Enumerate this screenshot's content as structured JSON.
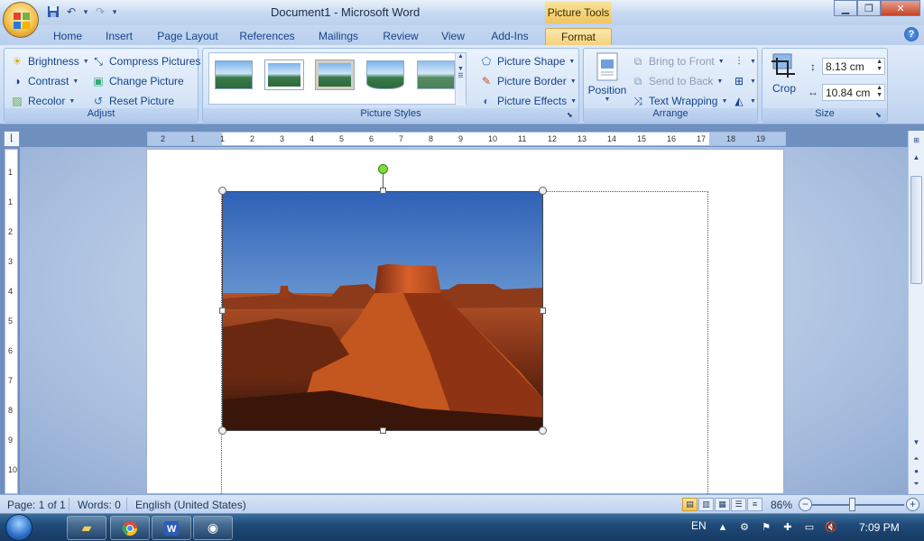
{
  "title_bar": {
    "window_title": "Document1 - Microsoft Word",
    "context_tab_group": "Picture Tools",
    "qat": {
      "save_icon": "save-icon",
      "undo_icon": "undo-icon",
      "redo_icon": "redo-icon"
    }
  },
  "tabs": [
    "Home",
    "Insert",
    "Page Layout",
    "References",
    "Mailings",
    "Review",
    "View",
    "Add-Ins",
    "Format"
  ],
  "active_tab": "Format",
  "ribbon": {
    "adjust": {
      "label": "Adjust",
      "brightness": "Brightness",
      "contrast": "Contrast",
      "recolor": "Recolor",
      "compress": "Compress Pictures",
      "change": "Change Picture",
      "reset": "Reset Picture"
    },
    "picture_styles": {
      "label": "Picture Styles",
      "shape": "Picture Shape",
      "border": "Picture Border",
      "effects": "Picture Effects"
    },
    "arrange": {
      "label": "Arrange",
      "position": "Position",
      "bring_to_front": "Bring to Front",
      "send_to_back": "Send to Back",
      "text_wrapping": "Text Wrapping"
    },
    "size": {
      "label": "Size",
      "crop": "Crop",
      "height": "8.13 cm",
      "width": "10.84 cm"
    }
  },
  "ruler": {
    "h_labels": [
      "2",
      "1",
      "1",
      "2",
      "3",
      "4",
      "5",
      "6",
      "7",
      "8",
      "9",
      "10",
      "11",
      "12",
      "13",
      "14",
      "15",
      "16",
      "17",
      "18",
      "19"
    ],
    "v_labels": [
      "1",
      "1",
      "2",
      "3",
      "4",
      "5",
      "6",
      "7",
      "8",
      "9",
      "10"
    ]
  },
  "status": {
    "page": "Page: 1 of 1",
    "words": "Words: 0",
    "language": "English (United States)",
    "zoom": "86%"
  },
  "taskbar": {
    "lang": "EN",
    "time": "7:09 PM"
  }
}
